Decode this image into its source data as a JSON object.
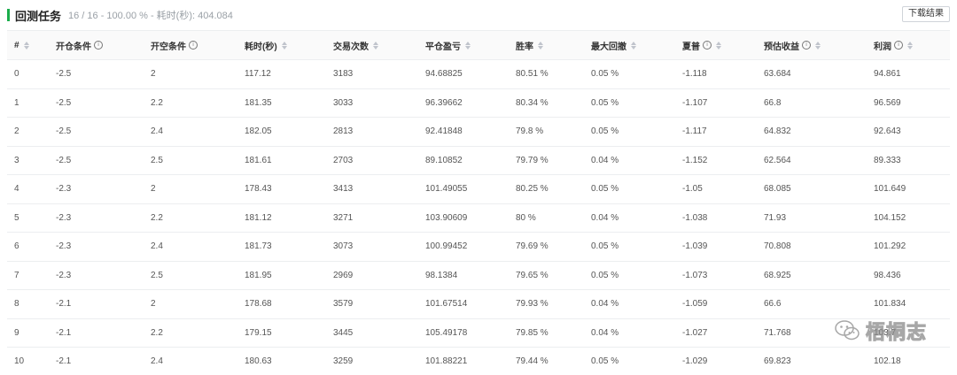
{
  "header": {
    "title": "回测任务",
    "summary": "16 / 16 - 100.00 % - 耗时(秒): 404.084",
    "download_label": "下载结果"
  },
  "table": {
    "columns": [
      {
        "label": "#",
        "info": false,
        "sort": true
      },
      {
        "label": "开仓条件",
        "info": true,
        "sort": false
      },
      {
        "label": "开空条件",
        "info": true,
        "sort": false
      },
      {
        "label": "耗时(秒)",
        "info": false,
        "sort": true
      },
      {
        "label": "交易次数",
        "info": false,
        "sort": true
      },
      {
        "label": "平仓盈亏",
        "info": false,
        "sort": true
      },
      {
        "label": "胜率",
        "info": false,
        "sort": true
      },
      {
        "label": "最大回撤",
        "info": false,
        "sort": true
      },
      {
        "label": "夏普",
        "info": true,
        "sort": true
      },
      {
        "label": "预估收益",
        "info": true,
        "sort": true
      },
      {
        "label": "利润",
        "info": true,
        "sort": true
      }
    ],
    "rows": [
      [
        "0",
        "-2.5",
        "2",
        "117.12",
        "3183",
        "94.68825",
        "80.51 %",
        "0.05 %",
        "-1.118",
        "63.684",
        "94.861"
      ],
      [
        "1",
        "-2.5",
        "2.2",
        "181.35",
        "3033",
        "96.39662",
        "80.34 %",
        "0.05 %",
        "-1.107",
        "66.8",
        "96.569"
      ],
      [
        "2",
        "-2.5",
        "2.4",
        "182.05",
        "2813",
        "92.41848",
        "79.8 %",
        "0.05 %",
        "-1.117",
        "64.832",
        "92.643"
      ],
      [
        "3",
        "-2.5",
        "2.5",
        "181.61",
        "2703",
        "89.10852",
        "79.79 %",
        "0.04 %",
        "-1.152",
        "62.564",
        "89.333"
      ],
      [
        "4",
        "-2.3",
        "2",
        "178.43",
        "3413",
        "101.49055",
        "80.25 %",
        "0.05 %",
        "-1.05",
        "68.085",
        "101.649"
      ],
      [
        "5",
        "-2.3",
        "2.2",
        "181.12",
        "3271",
        "103.90609",
        "80 %",
        "0.04 %",
        "-1.038",
        "71.93",
        "104.152"
      ],
      [
        "6",
        "-2.3",
        "2.4",
        "181.73",
        "3073",
        "100.99452",
        "79.69 %",
        "0.05 %",
        "-1.039",
        "70.808",
        "101.292"
      ],
      [
        "7",
        "-2.3",
        "2.5",
        "181.95",
        "2969",
        "98.1384",
        "79.65 %",
        "0.05 %",
        "-1.073",
        "68.925",
        "98.436"
      ],
      [
        "8",
        "-2.1",
        "2",
        "178.68",
        "3579",
        "101.67514",
        "79.93 %",
        "0.04 %",
        "-1.059",
        "66.6",
        "101.834"
      ],
      [
        "9",
        "-2.1",
        "2.2",
        "179.15",
        "3445",
        "105.49178",
        "79.85 %",
        "0.04 %",
        "-1.027",
        "71.768",
        "103.7"
      ],
      [
        "10",
        "-2.1",
        "2.4",
        "180.63",
        "3259",
        "101.88221",
        "79.44 %",
        "0.05 %",
        "-1.029",
        "69.823",
        "102.18"
      ]
    ]
  },
  "watermark": {
    "text": "梧桐志",
    "icon": "wechat-icon"
  },
  "colors": {
    "accent": "#1aad4b",
    "border": "#eceef0",
    "muted_text": "#9aa0a6"
  }
}
